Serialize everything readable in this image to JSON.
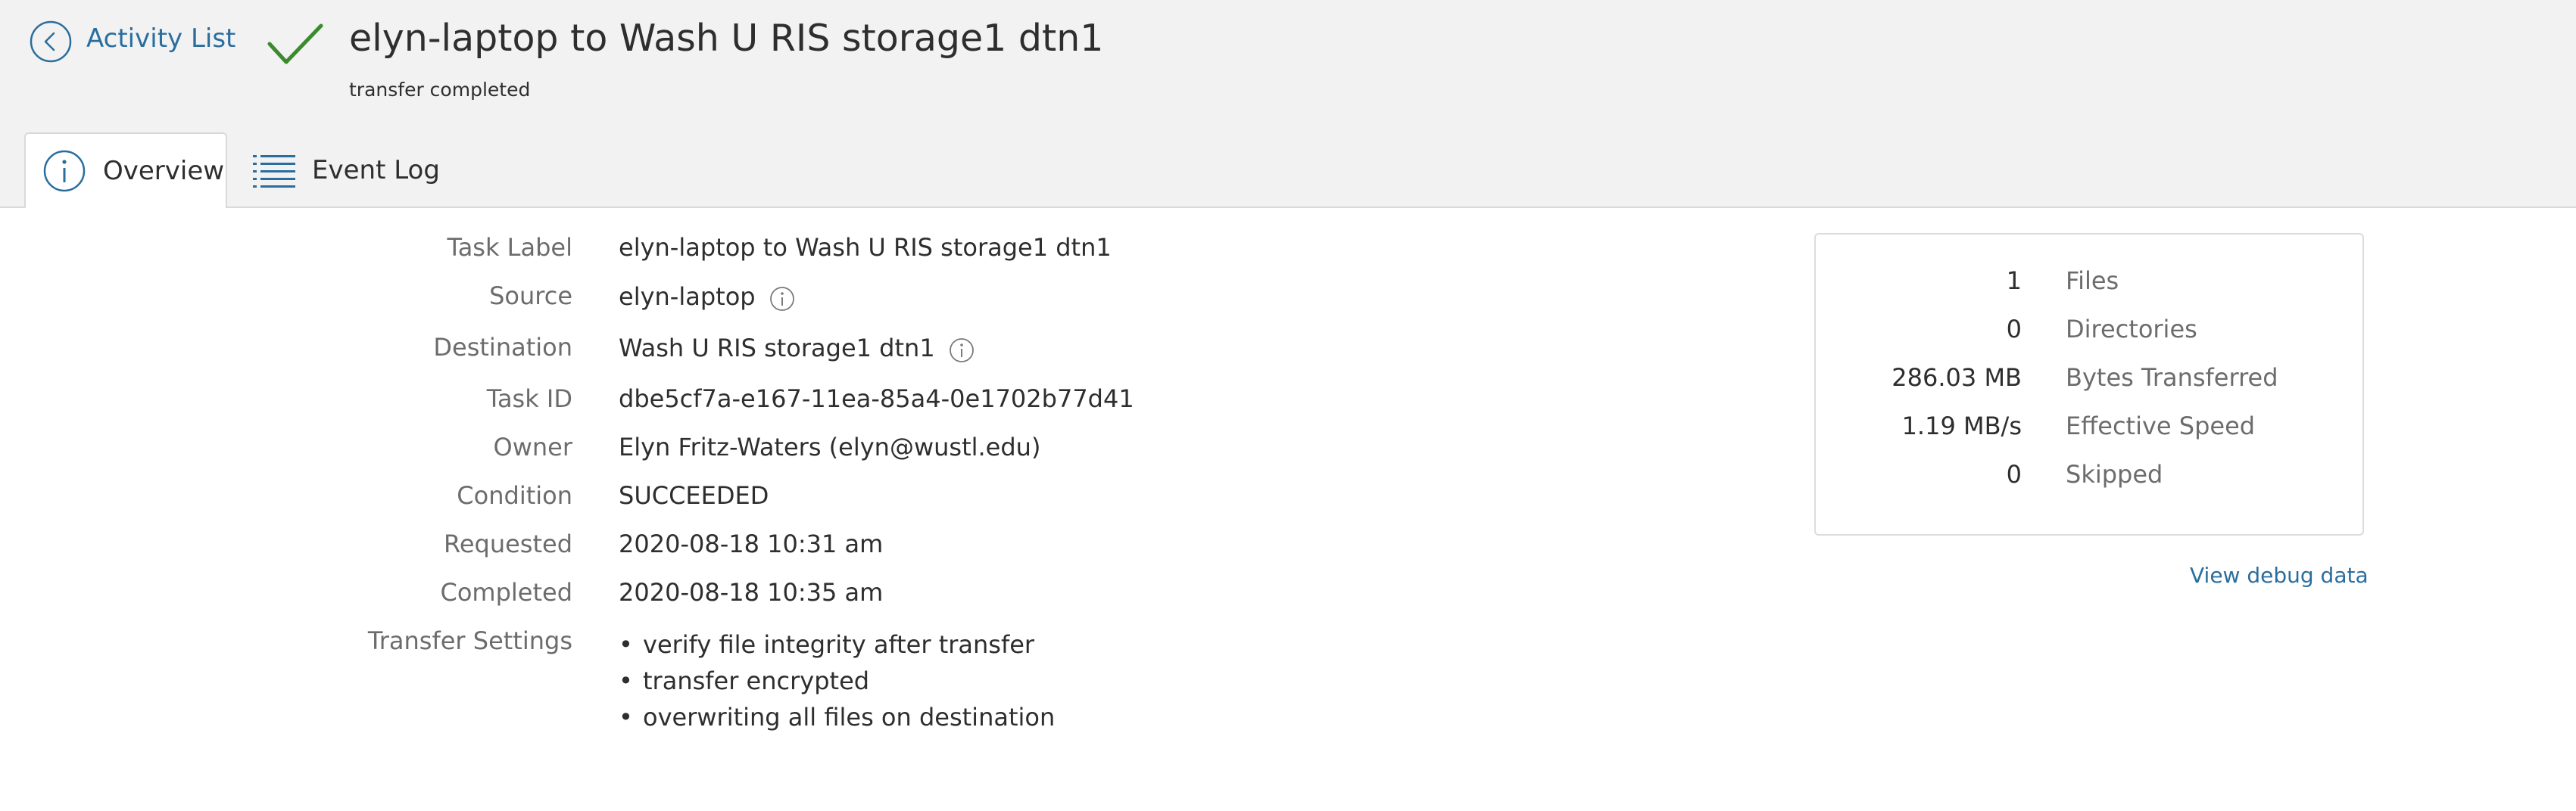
{
  "header": {
    "back_label": "Activity List",
    "title": "elyn-laptop to Wash U RIS storage1 dtn1",
    "subtitle": "transfer completed",
    "status_color": "#3b8a2e"
  },
  "tabs": [
    {
      "label": "Overview",
      "icon": "info-icon",
      "active": true
    },
    {
      "label": "Event Log",
      "icon": "list-icon",
      "active": false
    }
  ],
  "details": {
    "task_label": {
      "label": "Task Label",
      "value": "elyn-laptop to Wash U RIS storage1 dtn1"
    },
    "source": {
      "label": "Source",
      "value": "elyn-laptop"
    },
    "destination": {
      "label": "Destination",
      "value": "Wash U RIS storage1 dtn1"
    },
    "task_id": {
      "label": "Task ID",
      "value": "dbe5cf7a-e167-11ea-85a4-0e1702b77d41"
    },
    "owner": {
      "label": "Owner",
      "value": "Elyn Fritz-Waters (elyn@wustl.edu)"
    },
    "condition": {
      "label": "Condition",
      "value": "SUCCEEDED"
    },
    "requested": {
      "label": "Requested",
      "value": "2020-08-18 10:31 am"
    },
    "completed": {
      "label": "Completed",
      "value": "2020-08-18 10:35 am"
    },
    "transfer_settings": {
      "label": "Transfer Settings",
      "items": [
        "verify file integrity after transfer",
        "transfer encrypted",
        "overwriting all files on destination"
      ]
    }
  },
  "stats": [
    {
      "value": "1",
      "label": "Files"
    },
    {
      "value": "0",
      "label": "Directories"
    },
    {
      "value": "286.03 MB",
      "label": "Bytes Transferred"
    },
    {
      "value": "1.19 MB/s",
      "label": "Effective Speed"
    },
    {
      "value": "0",
      "label": "Skipped"
    }
  ],
  "debug_link": "View debug data",
  "colors": {
    "link": "#2a6e9e",
    "success": "#3b8a2e",
    "header_bg": "#f2f2f2"
  }
}
